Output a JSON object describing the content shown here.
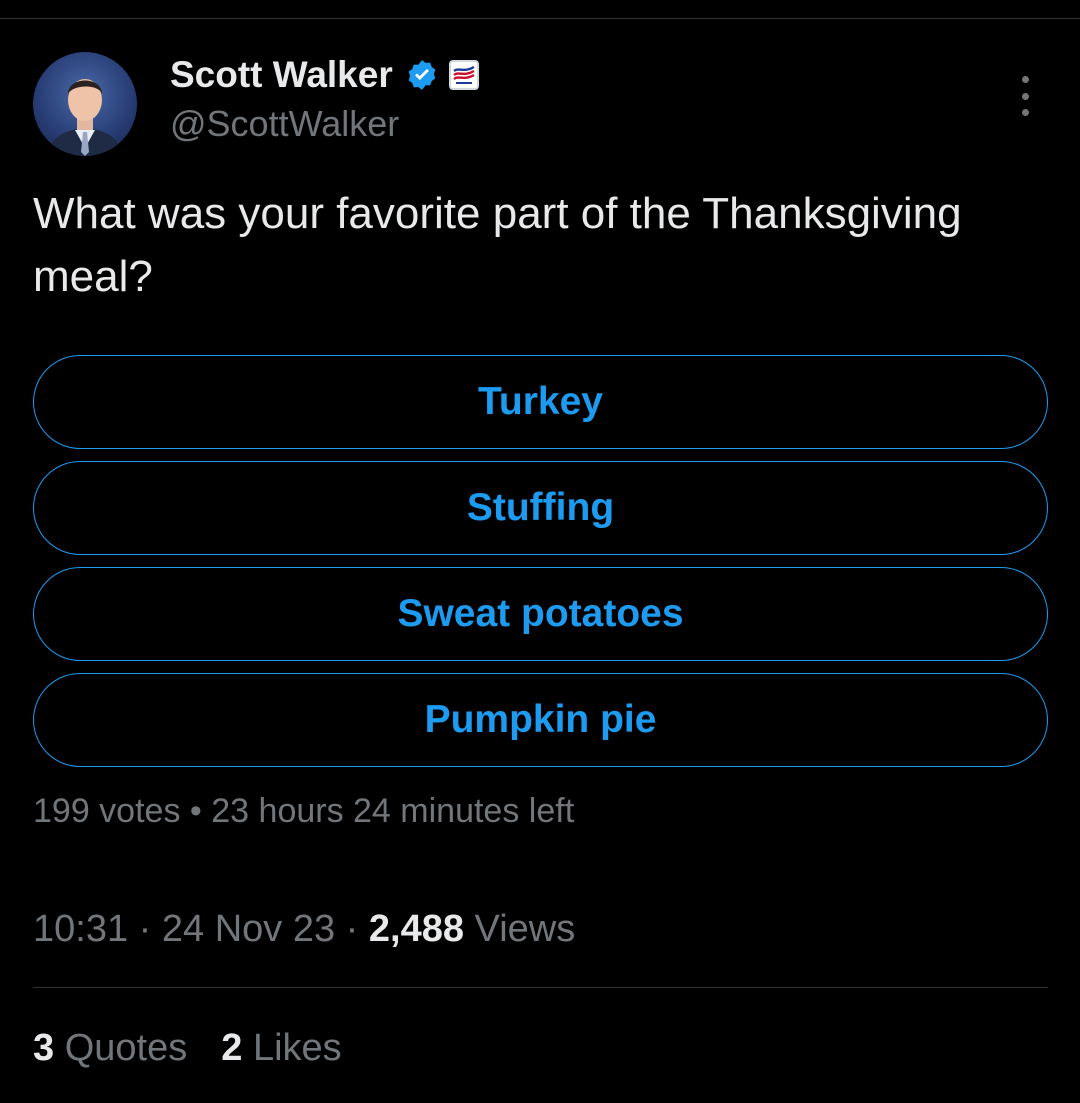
{
  "tweet": {
    "author": {
      "name": "Scott Walker",
      "handle": "@ScottWalker",
      "avatar_icon": "profile-photo",
      "verified_icon": "verified-badge-icon",
      "affiliation_icon": "flag-affiliation-icon"
    },
    "text": "What was your favorite part of the Thanksgiving meal?",
    "poll": {
      "options": [
        {
          "label": "Turkey"
        },
        {
          "label": "Stuffing"
        },
        {
          "label": "Sweat potatoes"
        },
        {
          "label": "Pumpkin pie"
        }
      ],
      "votes": "199 votes",
      "separator": "•",
      "time_left": "23 hours 24 minutes left"
    },
    "meta": {
      "time": "10:31",
      "date": "24 Nov 23",
      "separator": "·",
      "views_count": "2,488",
      "views_label": "Views"
    },
    "stats": {
      "quotes_count": "3",
      "quotes_label": "Quotes",
      "likes_count": "2",
      "likes_label": "Likes"
    }
  },
  "colors": {
    "background": "#000000",
    "accent": "#1d9bf0",
    "text_primary": "#e7e9ea",
    "text_secondary": "#71767b",
    "divider": "#2f3336"
  }
}
